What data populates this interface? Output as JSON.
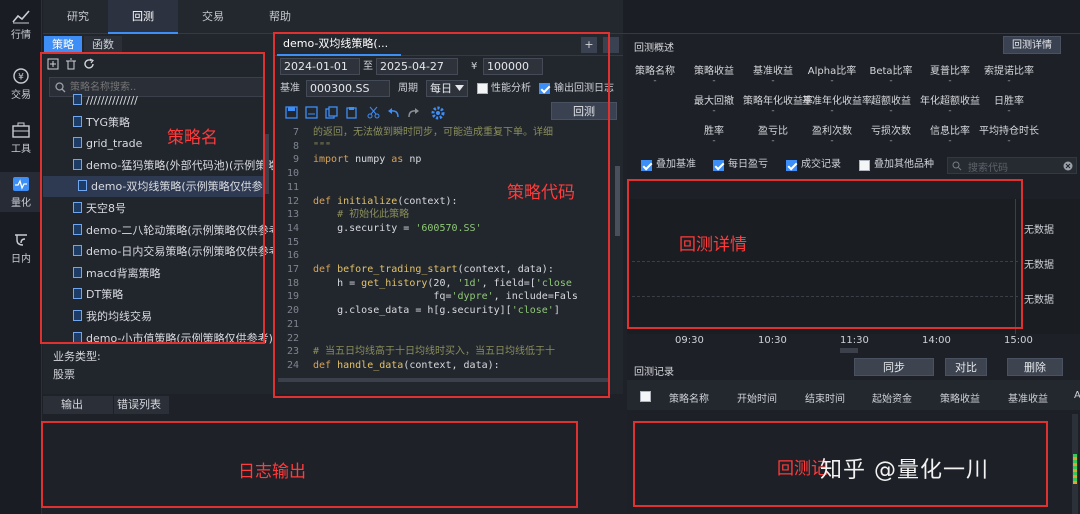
{
  "sidebar": {
    "items": [
      {
        "label": "行情",
        "icon": "chart-line-icon"
      },
      {
        "label": "交易",
        "icon": "exchange-icon"
      },
      {
        "label": "工具",
        "icon": "toolbox-icon"
      },
      {
        "label": "量化",
        "icon": "pulse-icon"
      },
      {
        "label": "日内",
        "icon": "intraday-icon"
      }
    ],
    "active": "量化"
  },
  "topnav": {
    "tabs": [
      "研究",
      "回测",
      "交易",
      "帮助"
    ],
    "active": "回测"
  },
  "left_panel": {
    "subtabs": [
      "策略",
      "函数"
    ],
    "search_placeholder": "策略名称搜索..",
    "strategies": [
      "//////////////",
      "TYG策略",
      "grid_trade",
      "demo-猛犸策略(外部代码池)(示例策略仅供参考)",
      "demo-双均线策略(示例策略仅供参考)",
      "天空8号",
      "demo-二八轮动策略(示例策略仅供参考)",
      "demo-日内交易策略(示例策略仅供参考)",
      "macd背离策略",
      "DT策略",
      "我的均线交易",
      "demo-小市值策略(示例策略仅供参考)"
    ],
    "business_type_label": "业务类型:",
    "business_type_value": "股票",
    "annotation": "策略名"
  },
  "editor": {
    "tab_title": "demo-双均线策略(...",
    "close_glyph": "✕",
    "add_glyph": "+",
    "start_date": "2024-01-01",
    "to_label": "至",
    "end_date": "2025-04-27",
    "currency": "¥",
    "capital": "100000",
    "benchmark_label": "基准",
    "benchmark_value": "000300.SS",
    "period_label": "周期",
    "period_value": "每日",
    "perf_label": "性能分析",
    "log_label": "输出回测日志",
    "run_button": "回测",
    "annotation": "策略代码",
    "code_lines": [
      {
        "n": "7",
        "html": "<span class='cm'>的返回，无法做到瞬时同步，可能造成重复下单。详细</span>"
      },
      {
        "n": "8",
        "html": "<span class='cm'>\"\"\"</span>"
      },
      {
        "n": "9",
        "html": "<span class='kw'>import</span><span class='pl'> numpy </span><span class='kw'>as</span><span class='pl'> np</span>"
      },
      {
        "n": "10",
        "html": ""
      },
      {
        "n": "11",
        "html": ""
      },
      {
        "n": "12",
        "html": "<span class='kw'>def</span><span class='pl'> </span><span class='fn'>initialize</span><span class='pl'>(context):</span>"
      },
      {
        "n": "13",
        "html": "<span class='cm'>    # 初始化此策略</span>"
      },
      {
        "n": "14",
        "html": "<span class='pl'>    g.security = </span><span class='st'>'600570.SS'</span>"
      },
      {
        "n": "15",
        "html": ""
      },
      {
        "n": "16",
        "html": ""
      },
      {
        "n": "17",
        "html": "<span class='kw'>def</span><span class='pl'> </span><span class='fn'>before_trading_start</span><span class='pl'>(context, data):</span>"
      },
      {
        "n": "18",
        "html": "<span class='pl'>    h = </span><span class='fn'>get_history</span><span class='pl'>(20, </span><span class='st'>'1d'</span><span class='pl'>, field=[</span><span class='st'>'close</span>"
      },
      {
        "n": "19",
        "html": "<span class='pl'>                    fq=</span><span class='st'>'dypre'</span><span class='pl'>, include=Fals</span>"
      },
      {
        "n": "20",
        "html": "<span class='pl'>    g.close_data = h[g.security][</span><span class='st'>'close'</span><span class='pl'>]</span>"
      },
      {
        "n": "21",
        "html": ""
      },
      {
        "n": "22",
        "html": ""
      },
      {
        "n": "23",
        "html": "<span class='cm'># 当五日均线高于十日均线时买入，当五日均线低于十</span>"
      },
      {
        "n": "24",
        "html": "<span class='kw'>def</span><span class='pl'> </span><span class='fn'>handle_data</span><span class='pl'>(context, data):</span>"
      }
    ]
  },
  "right_panel": {
    "title": "回测概述",
    "detail_button": "回测详情",
    "metrics_row1": [
      "策略名称",
      "策略收益",
      "基准收益",
      "Alpha比率",
      "Beta比率",
      "夏普比率",
      "索提诺比率"
    ],
    "metrics_row2": [
      "最大回撤",
      "策略年化收益率",
      "基准年化收益率",
      "超额收益",
      "年化超额收益",
      "日胜率"
    ],
    "metrics_row3": [
      "胜率",
      "盈亏比",
      "盈利次数",
      "亏损次数",
      "信息比率",
      "平均持仓时长"
    ],
    "dash": "-",
    "options": [
      {
        "label": "叠加基准",
        "checked": true
      },
      {
        "label": "每日盈亏",
        "checked": true
      },
      {
        "label": "成交记录",
        "checked": true
      },
      {
        "label": "叠加其他品种",
        "checked": false
      }
    ],
    "search_placeholder": "搜索代码",
    "no_data": "无数据",
    "time_ticks": [
      "09:30",
      "10:30",
      "11:30",
      "14:00",
      "15:00"
    ],
    "annotation": "回测详情",
    "buttons": [
      "同步",
      "对比",
      "删除"
    ],
    "records_title": "回测记录",
    "record_columns": [
      "策略名称",
      "开始时间",
      "结束时间",
      "起始资金",
      "策略收益",
      "基准收益",
      "A"
    ],
    "records_annotation": "回测记"
  },
  "bottom_left": {
    "tabs": [
      "输出",
      "错误列表"
    ],
    "annotation": "日志输出"
  },
  "watermark": "知乎 @量化一川",
  "colors": {
    "accent": "#3e8ef7",
    "annotation_red": "#e03131",
    "background": "#1e2128"
  }
}
